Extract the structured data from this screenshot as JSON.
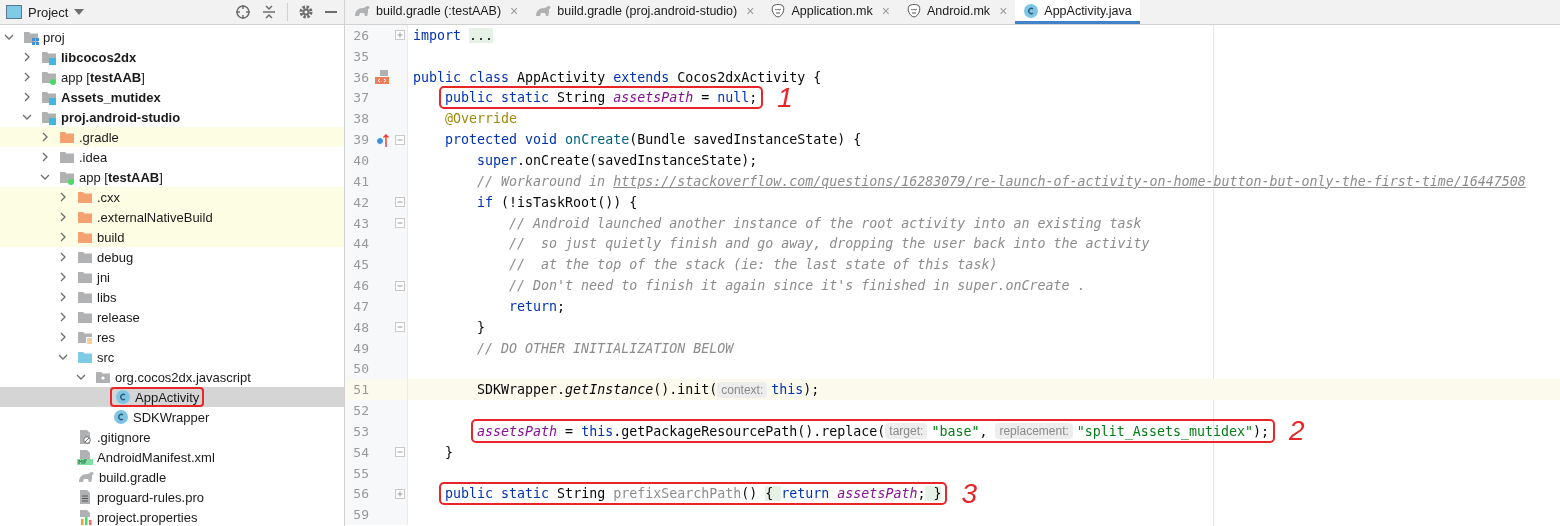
{
  "project_panel": {
    "title": "Project",
    "tree": [
      {
        "label": "proj",
        "kind": "project",
        "expanded": true,
        "selected": false,
        "children": [
          {
            "label": "libcocos2dx",
            "kind": "module",
            "expanded": false,
            "selected": false
          },
          {
            "label": "app [**testAAB**]",
            "kind": "app-module",
            "expanded": false,
            "selected": false
          },
          {
            "label": "Assets_mutidex",
            "kind": "module",
            "expanded": false,
            "selected": false
          },
          {
            "label": "proj.android-studio",
            "kind": "module",
            "expanded": true,
            "selected": false,
            "children": [
              {
                "label": ".gradle",
                "kind": "excluded-folder",
                "expanded": false,
                "selected": false
              },
              {
                "label": ".idea",
                "kind": "folder",
                "expanded": false,
                "selected": false
              },
              {
                "label": "app [**testAAB**]",
                "kind": "app-module",
                "expanded": true,
                "selected": false,
                "children": [
                  {
                    "label": ".cxx",
                    "kind": "excluded-folder",
                    "expanded": false,
                    "selected": false
                  },
                  {
                    "label": ".externalNativeBuild",
                    "kind": "excluded-folder",
                    "expanded": false,
                    "selected": false
                  },
                  {
                    "label": "build",
                    "kind": "excluded-folder",
                    "expanded": false,
                    "selected": false
                  },
                  {
                    "label": "debug",
                    "kind": "folder",
                    "expanded": false,
                    "selected": false
                  },
                  {
                    "label": "jni",
                    "kind": "folder",
                    "expanded": false,
                    "selected": false
                  },
                  {
                    "label": "libs",
                    "kind": "folder",
                    "expanded": false,
                    "selected": false
                  },
                  {
                    "label": "release",
                    "kind": "folder",
                    "expanded": false,
                    "selected": false
                  },
                  {
                    "label": "res",
                    "kind": "res-folder",
                    "expanded": false,
                    "selected": false
                  },
                  {
                    "label": "src",
                    "kind": "source-folder",
                    "expanded": true,
                    "selected": false,
                    "children": [
                      {
                        "label": "org.cocos2dx.javascript",
                        "kind": "package",
                        "expanded": true,
                        "selected": false,
                        "children": [
                          {
                            "label": "AppActivity",
                            "kind": "class",
                            "selected": true,
                            "boxed": true
                          },
                          {
                            "label": "SDKWrapper",
                            "kind": "class",
                            "selected": false,
                            "boxed": false
                          }
                        ]
                      }
                    ]
                  },
                  {
                    "label": ".gitignore",
                    "kind": "gitignore",
                    "selected": false
                  },
                  {
                    "label": "AndroidManifest.xml",
                    "kind": "manifest",
                    "selected": false
                  },
                  {
                    "label": "build.gradle",
                    "kind": "gradle",
                    "selected": false
                  },
                  {
                    "label": "proguard-rules.pro",
                    "kind": "text-file",
                    "selected": false
                  },
                  {
                    "label": "project.properties",
                    "kind": "properties",
                    "selected": false
                  }
                ]
              }
            ]
          }
        ]
      }
    ]
  },
  "tabs": [
    {
      "label": "build.gradle (:testAAB)",
      "kind": "gradle",
      "close": "×",
      "selected": false
    },
    {
      "label": "build.gradle (proj.android-studio)",
      "kind": "gradle",
      "close": "×",
      "selected": false
    },
    {
      "label": "Application.mk",
      "kind": "makefile",
      "close": "×",
      "selected": false
    },
    {
      "label": "Android.mk",
      "kind": "makefile",
      "close": "×",
      "selected": false
    },
    {
      "label": "AppActivity.java",
      "kind": "class",
      "selected": true
    }
  ],
  "editor": {
    "lines": [
      {
        "number": "26",
        "foldable": true,
        "collapsed": true,
        "tokens": [
          {
            "kind": "keyword",
            "text": "import "
          },
          {
            "kind": "folded",
            "text": "..."
          }
        ]
      },
      {
        "number": "35"
      },
      {
        "number": "36",
        "implemented": true,
        "tokens": [
          {
            "kind": "keyword",
            "text": "public class"
          },
          {
            "kind": "plain",
            "text": " AppActivity "
          },
          {
            "kind": "keyword",
            "text": "extends"
          },
          {
            "kind": "plain",
            "text": " Cocos2dxActivity {"
          }
        ]
      },
      {
        "number": "37",
        "boxed": true,
        "mark": "1",
        "tokens": [
          {
            "kind": "keyword",
            "text": "    public static"
          },
          {
            "kind": "plain",
            "text": " String "
          },
          {
            "kind": "field",
            "text": "assetsPath"
          },
          {
            "kind": "plain",
            "text": " = "
          },
          {
            "kind": "keyword",
            "text": "null"
          },
          {
            "kind": "plain",
            "text": ";"
          }
        ]
      },
      {
        "number": "38",
        "tokens": [
          {
            "kind": "annotation",
            "text": "    @Override"
          }
        ]
      },
      {
        "number": "39",
        "overrides": true,
        "foldable": true,
        "collapsed": false,
        "tokens": [
          {
            "kind": "keyword",
            "text": "    protected void"
          },
          {
            "kind": "method",
            "text": " onCreate"
          },
          {
            "kind": "plain",
            "text": "(Bundle savedInstanceState) {"
          }
        ]
      },
      {
        "number": "40",
        "tokens": [
          {
            "kind": "keyword",
            "text": "        super"
          },
          {
            "kind": "plain",
            "text": ".onCreate(savedInstanceState);"
          }
        ]
      },
      {
        "number": "41",
        "tokens": [
          {
            "kind": "comment",
            "text": "        // Workaround in "
          },
          {
            "kind": "link",
            "text": "https://stackoverflow.com/questions/16283079/re-launch-of-activity-on-home-button-but-only-the-first-time/16447508"
          }
        ]
      },
      {
        "number": "42",
        "foldable": true,
        "collapsed": false,
        "tokens": [
          {
            "kind": "keyword",
            "text": "        if"
          },
          {
            "kind": "plain",
            "text": " (!isTaskRoot()) {"
          }
        ]
      },
      {
        "number": "43",
        "foldable": true,
        "collapsed": false,
        "tokens": [
          {
            "kind": "comment",
            "text": "            // Android launched another instance of the root activity into an existing task"
          }
        ]
      },
      {
        "number": "44",
        "tokens": [
          {
            "kind": "comment",
            "text": "            //  so just quietly finish and go away, dropping the user back into the activity"
          }
        ]
      },
      {
        "number": "45",
        "tokens": [
          {
            "kind": "comment",
            "text": "            //  at the top of the stack (ie: the last state of this task)"
          }
        ]
      },
      {
        "number": "46",
        "foldable": true,
        "collapsed": false,
        "tokens": [
          {
            "kind": "comment",
            "text": "            // Don't need to finish it again since it's finished in super.onCreate ."
          }
        ]
      },
      {
        "number": "47",
        "tokens": [
          {
            "kind": "keyword",
            "text": "            return"
          },
          {
            "kind": "plain",
            "text": ";"
          }
        ]
      },
      {
        "number": "48",
        "foldable": true,
        "collapsed": false,
        "tokens": [
          {
            "kind": "plain",
            "text": "        }"
          }
        ]
      },
      {
        "number": "49",
        "tokens": [
          {
            "kind": "comment",
            "text": "        // DO OTHER INITIALIZATION BELOW"
          }
        ]
      },
      {
        "number": "50"
      },
      {
        "number": "51",
        "current": true,
        "tokens": [
          {
            "kind": "plain",
            "text": "        SDKWrapper."
          },
          {
            "kind": "static-call",
            "text": "getInstance"
          },
          {
            "kind": "plain",
            "text": "().init("
          },
          {
            "kind": "hint",
            "text": "context:"
          },
          {
            "kind": "keyword",
            "text": "this"
          },
          {
            "kind": "plain",
            "text": ");"
          }
        ]
      },
      {
        "number": "52"
      },
      {
        "number": "53",
        "boxed": true,
        "mark": "2",
        "tokens": [
          {
            "kind": "field",
            "text": "        assetsPath"
          },
          {
            "kind": "plain",
            "text": " = "
          },
          {
            "kind": "keyword",
            "text": "this"
          },
          {
            "kind": "plain",
            "text": ".getPackageResourcePath().replace("
          },
          {
            "kind": "hint",
            "text": "target:"
          },
          {
            "kind": "string",
            "text": "\"base\""
          },
          {
            "kind": "plain",
            "text": ", "
          },
          {
            "kind": "hint",
            "text": "replacement:"
          },
          {
            "kind": "string",
            "text": "\"split_Assets_mutidex\""
          },
          {
            "kind": "plain",
            "text": ");"
          }
        ]
      },
      {
        "number": "54",
        "foldable": true,
        "collapsed": false,
        "tokens": [
          {
            "kind": "plain",
            "text": "    }"
          }
        ]
      },
      {
        "number": "55"
      },
      {
        "number": "56",
        "foldable": true,
        "collapsed": true,
        "boxed": true,
        "mark": "3",
        "tokens": [
          {
            "kind": "keyword",
            "text": "    public static"
          },
          {
            "kind": "plain",
            "text": " String "
          },
          {
            "kind": "unused",
            "text": "prefixSearchPath"
          },
          {
            "kind": "plain",
            "text": "() "
          },
          {
            "kind": "folded",
            "text": "{ "
          },
          {
            "kind": "keyword",
            "text": "return"
          },
          {
            "kind": "field",
            "text": " assetsPath"
          },
          {
            "kind": "plain",
            "text": ";"
          },
          {
            "kind": "folded",
            "text": " }"
          }
        ]
      },
      {
        "number": "59"
      }
    ]
  }
}
